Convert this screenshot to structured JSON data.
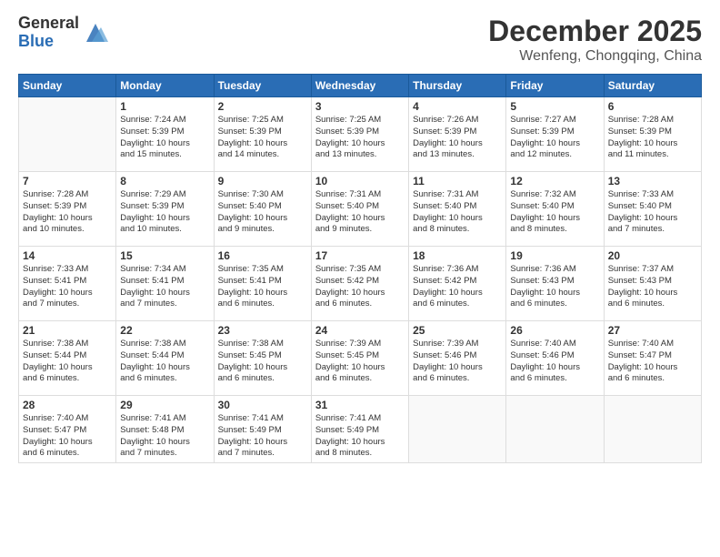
{
  "logo": {
    "general": "General",
    "blue": "Blue"
  },
  "title": "December 2025",
  "location": "Wenfeng, Chongqing, China",
  "headers": [
    "Sunday",
    "Monday",
    "Tuesday",
    "Wednesday",
    "Thursday",
    "Friday",
    "Saturday"
  ],
  "weeks": [
    [
      {
        "day": "",
        "info": ""
      },
      {
        "day": "1",
        "info": "Sunrise: 7:24 AM\nSunset: 5:39 PM\nDaylight: 10 hours\nand 15 minutes."
      },
      {
        "day": "2",
        "info": "Sunrise: 7:25 AM\nSunset: 5:39 PM\nDaylight: 10 hours\nand 14 minutes."
      },
      {
        "day": "3",
        "info": "Sunrise: 7:25 AM\nSunset: 5:39 PM\nDaylight: 10 hours\nand 13 minutes."
      },
      {
        "day": "4",
        "info": "Sunrise: 7:26 AM\nSunset: 5:39 PM\nDaylight: 10 hours\nand 13 minutes."
      },
      {
        "day": "5",
        "info": "Sunrise: 7:27 AM\nSunset: 5:39 PM\nDaylight: 10 hours\nand 12 minutes."
      },
      {
        "day": "6",
        "info": "Sunrise: 7:28 AM\nSunset: 5:39 PM\nDaylight: 10 hours\nand 11 minutes."
      }
    ],
    [
      {
        "day": "7",
        "info": "Sunrise: 7:28 AM\nSunset: 5:39 PM\nDaylight: 10 hours\nand 10 minutes."
      },
      {
        "day": "8",
        "info": "Sunrise: 7:29 AM\nSunset: 5:39 PM\nDaylight: 10 hours\nand 10 minutes."
      },
      {
        "day": "9",
        "info": "Sunrise: 7:30 AM\nSunset: 5:40 PM\nDaylight: 10 hours\nand 9 minutes."
      },
      {
        "day": "10",
        "info": "Sunrise: 7:31 AM\nSunset: 5:40 PM\nDaylight: 10 hours\nand 9 minutes."
      },
      {
        "day": "11",
        "info": "Sunrise: 7:31 AM\nSunset: 5:40 PM\nDaylight: 10 hours\nand 8 minutes."
      },
      {
        "day": "12",
        "info": "Sunrise: 7:32 AM\nSunset: 5:40 PM\nDaylight: 10 hours\nand 8 minutes."
      },
      {
        "day": "13",
        "info": "Sunrise: 7:33 AM\nSunset: 5:40 PM\nDaylight: 10 hours\nand 7 minutes."
      }
    ],
    [
      {
        "day": "14",
        "info": "Sunrise: 7:33 AM\nSunset: 5:41 PM\nDaylight: 10 hours\nand 7 minutes."
      },
      {
        "day": "15",
        "info": "Sunrise: 7:34 AM\nSunset: 5:41 PM\nDaylight: 10 hours\nand 7 minutes."
      },
      {
        "day": "16",
        "info": "Sunrise: 7:35 AM\nSunset: 5:41 PM\nDaylight: 10 hours\nand 6 minutes."
      },
      {
        "day": "17",
        "info": "Sunrise: 7:35 AM\nSunset: 5:42 PM\nDaylight: 10 hours\nand 6 minutes."
      },
      {
        "day": "18",
        "info": "Sunrise: 7:36 AM\nSunset: 5:42 PM\nDaylight: 10 hours\nand 6 minutes."
      },
      {
        "day": "19",
        "info": "Sunrise: 7:36 AM\nSunset: 5:43 PM\nDaylight: 10 hours\nand 6 minutes."
      },
      {
        "day": "20",
        "info": "Sunrise: 7:37 AM\nSunset: 5:43 PM\nDaylight: 10 hours\nand 6 minutes."
      }
    ],
    [
      {
        "day": "21",
        "info": "Sunrise: 7:38 AM\nSunset: 5:44 PM\nDaylight: 10 hours\nand 6 minutes."
      },
      {
        "day": "22",
        "info": "Sunrise: 7:38 AM\nSunset: 5:44 PM\nDaylight: 10 hours\nand 6 minutes."
      },
      {
        "day": "23",
        "info": "Sunrise: 7:38 AM\nSunset: 5:45 PM\nDaylight: 10 hours\nand 6 minutes."
      },
      {
        "day": "24",
        "info": "Sunrise: 7:39 AM\nSunset: 5:45 PM\nDaylight: 10 hours\nand 6 minutes."
      },
      {
        "day": "25",
        "info": "Sunrise: 7:39 AM\nSunset: 5:46 PM\nDaylight: 10 hours\nand 6 minutes."
      },
      {
        "day": "26",
        "info": "Sunrise: 7:40 AM\nSunset: 5:46 PM\nDaylight: 10 hours\nand 6 minutes."
      },
      {
        "day": "27",
        "info": "Sunrise: 7:40 AM\nSunset: 5:47 PM\nDaylight: 10 hours\nand 6 minutes."
      }
    ],
    [
      {
        "day": "28",
        "info": "Sunrise: 7:40 AM\nSunset: 5:47 PM\nDaylight: 10 hours\nand 6 minutes."
      },
      {
        "day": "29",
        "info": "Sunrise: 7:41 AM\nSunset: 5:48 PM\nDaylight: 10 hours\nand 7 minutes."
      },
      {
        "day": "30",
        "info": "Sunrise: 7:41 AM\nSunset: 5:49 PM\nDaylight: 10 hours\nand 7 minutes."
      },
      {
        "day": "31",
        "info": "Sunrise: 7:41 AM\nSunset: 5:49 PM\nDaylight: 10 hours\nand 8 minutes."
      },
      {
        "day": "",
        "info": ""
      },
      {
        "day": "",
        "info": ""
      },
      {
        "day": "",
        "info": ""
      }
    ]
  ]
}
